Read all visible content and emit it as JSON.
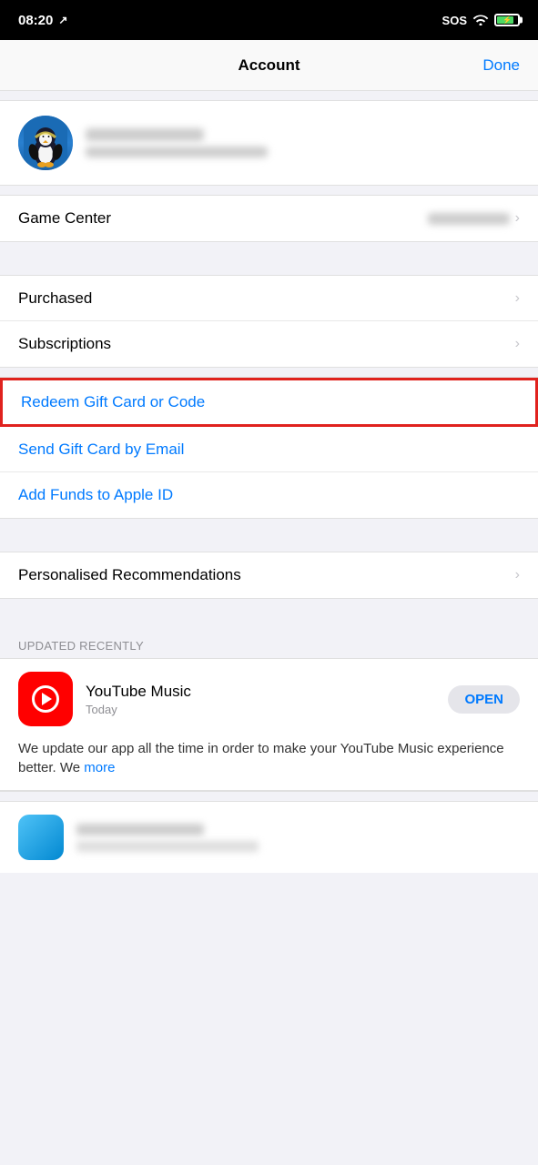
{
  "status": {
    "time": "08:20",
    "sos": "SOS"
  },
  "nav": {
    "title": "Account",
    "done": "Done"
  },
  "profile": {
    "name_blur": true,
    "email_blur": true
  },
  "gameCenter": {
    "label": "Game Center",
    "value_blur": true
  },
  "menuItems": [
    {
      "id": "purchased",
      "label": "Purchased",
      "type": "chevron"
    },
    {
      "id": "subscriptions",
      "label": "Subscriptions",
      "type": "chevron"
    }
  ],
  "giftItems": [
    {
      "id": "redeem",
      "label": "Redeem Gift Card or Code",
      "highlighted": true
    },
    {
      "id": "send-gift",
      "label": "Send Gift Card by Email",
      "highlighted": false
    },
    {
      "id": "add-funds",
      "label": "Add Funds to Apple ID",
      "highlighted": false
    }
  ],
  "personalizedRow": {
    "label": "Personalised Recommendations",
    "type": "chevron"
  },
  "updatedSection": {
    "header": "Updated Recently"
  },
  "youtubeMusic": {
    "name": "YouTube Music",
    "time": "Today",
    "openButton": "OPEN",
    "description": "We update our app all the time in order to make your YouTube Music experience better. We",
    "more": "more"
  }
}
